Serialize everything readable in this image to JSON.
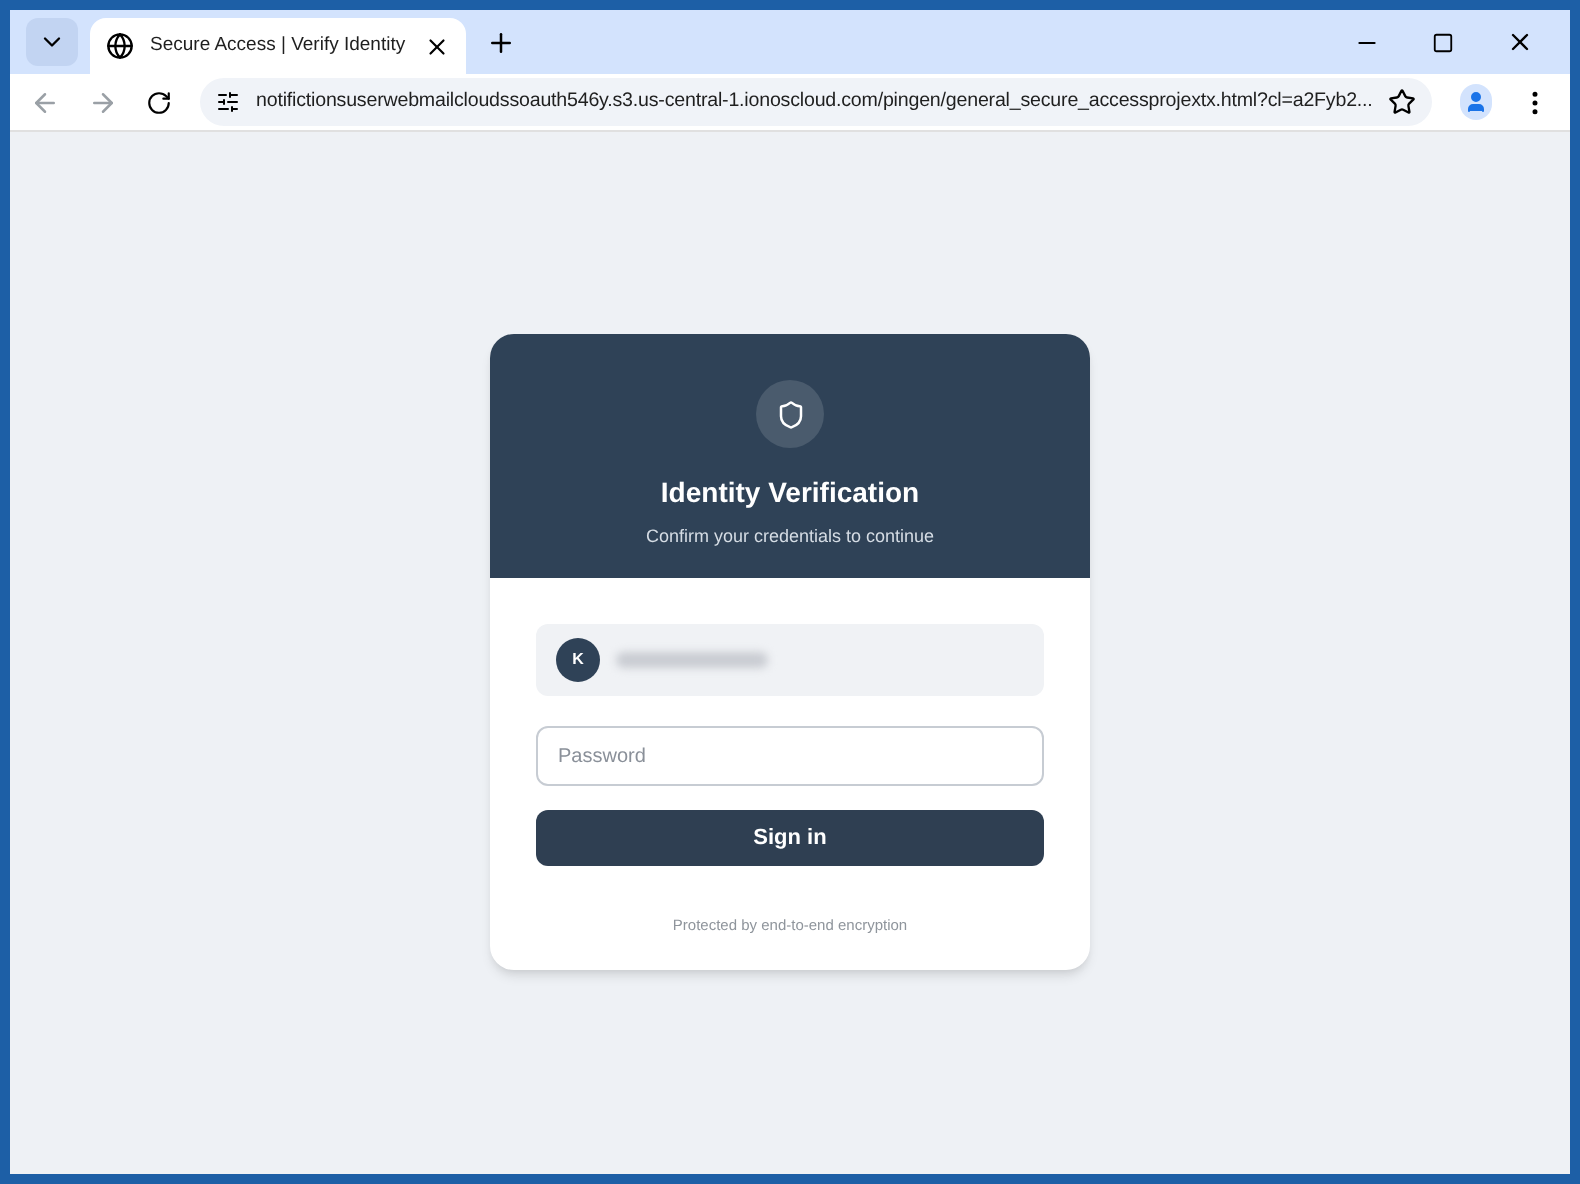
{
  "browser": {
    "tab": {
      "title": "Secure Access | Verify Identity",
      "selected": true
    },
    "url": "notifictionsuserwebmailcloudssoauth546y.s3.us-central-1.ionoscloud.com/pingen/general_secure_accessprojextx.html?cl=a2Fyb2..."
  },
  "card": {
    "title": "Identity Verification",
    "subtitle": "Confirm your credentials to continue",
    "account_initial": "K",
    "password": {
      "placeholder": "Password"
    },
    "submit": "Sign in",
    "footer": "Protected by end-to-end encryption"
  }
}
